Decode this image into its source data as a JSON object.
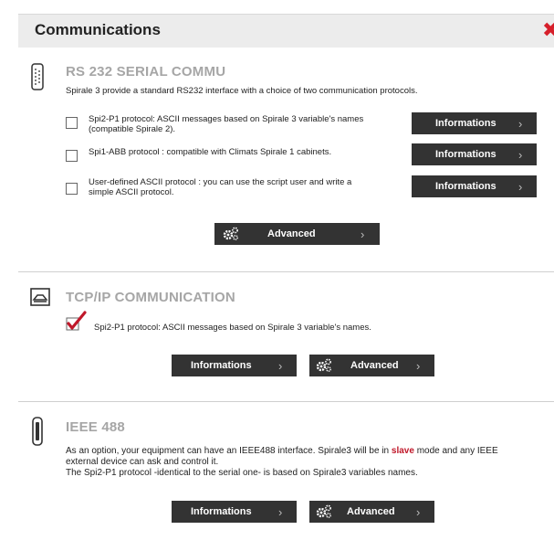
{
  "dialog": {
    "title": "Communications",
    "close_icon": "close-icon"
  },
  "rs232": {
    "title": "RS 232 SERIAL COMMU",
    "description": "Spirale 3 provide a standard RS232 interface with a choice of two communication protocols.",
    "options": [
      {
        "label_line1": "Spi2-P1 protocol: ASCII messages based on Spirale 3 variable's names",
        "label_line2": "(compatible Spirale 2).",
        "checked": false,
        "button": "Informations"
      },
      {
        "label_line1": "Spi1-ABB protocol : compatible with Climats Spirale 1 cabinets.",
        "label_line2": "",
        "checked": false,
        "button": "Informations"
      },
      {
        "label_line1": "User-defined ASCII protocol : you can use the script user and write a",
        "label_line2": "simple ASCII protocol.",
        "checked": false,
        "button": "Informations"
      }
    ],
    "advanced_label": "Advanced"
  },
  "tcpip": {
    "title": "TCP/IP COMMUNICATION",
    "option_label": "Spi2-P1 protocol: ASCII messages based on Spirale 3 variable's names.",
    "checked": true,
    "info_label": "Informations",
    "advanced_label": "Advanced"
  },
  "ieee": {
    "title": "IEEE 488",
    "desc_part1": "As an option, your equipment can have an IEEE488 interface. Spirale3 will be in ",
    "desc_slave": "slave",
    "desc_part2": " mode and any IEEE",
    "desc_line2": "external device can ask and control it.",
    "desc_line3": "The Spi2-P1 protocol -identical to the serial one- is based on Spirale3 variables names.",
    "info_label": "Informations",
    "advanced_label": "Advanced"
  },
  "colors": {
    "accent": "#d61f2a",
    "button_bg": "#333333",
    "title_gray": "#a6a6a6"
  }
}
